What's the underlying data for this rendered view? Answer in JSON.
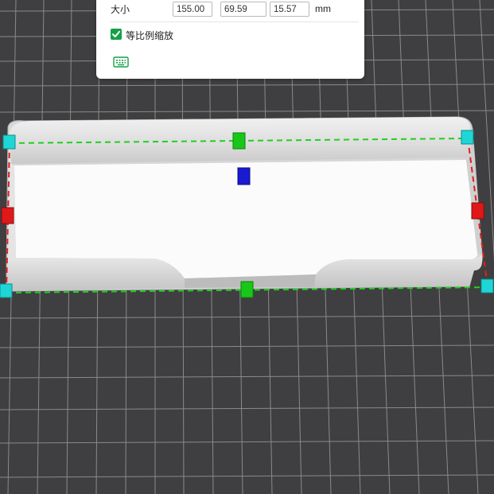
{
  "scale_panel": {
    "size_label": "大小",
    "size_x": "155.00",
    "size_y": "69.59",
    "size_z": "15.57",
    "unit": "mm",
    "uniform_scale_label": "等比例缩放",
    "uniform_scale_checked": true,
    "accent_color": "#15a148"
  },
  "icons": {
    "checkbox": "checkmark-icon",
    "keyboard": "keyboard-icon"
  },
  "viewport": {
    "background_color": "#3f3f41",
    "grid_color": "#8a8a8a",
    "bounding_box_colors": {
      "x_axis": "#e02020",
      "y_axis": "#20d020",
      "corner": "#1fd6d6",
      "z_handle": "#1a1ad0"
    }
  }
}
